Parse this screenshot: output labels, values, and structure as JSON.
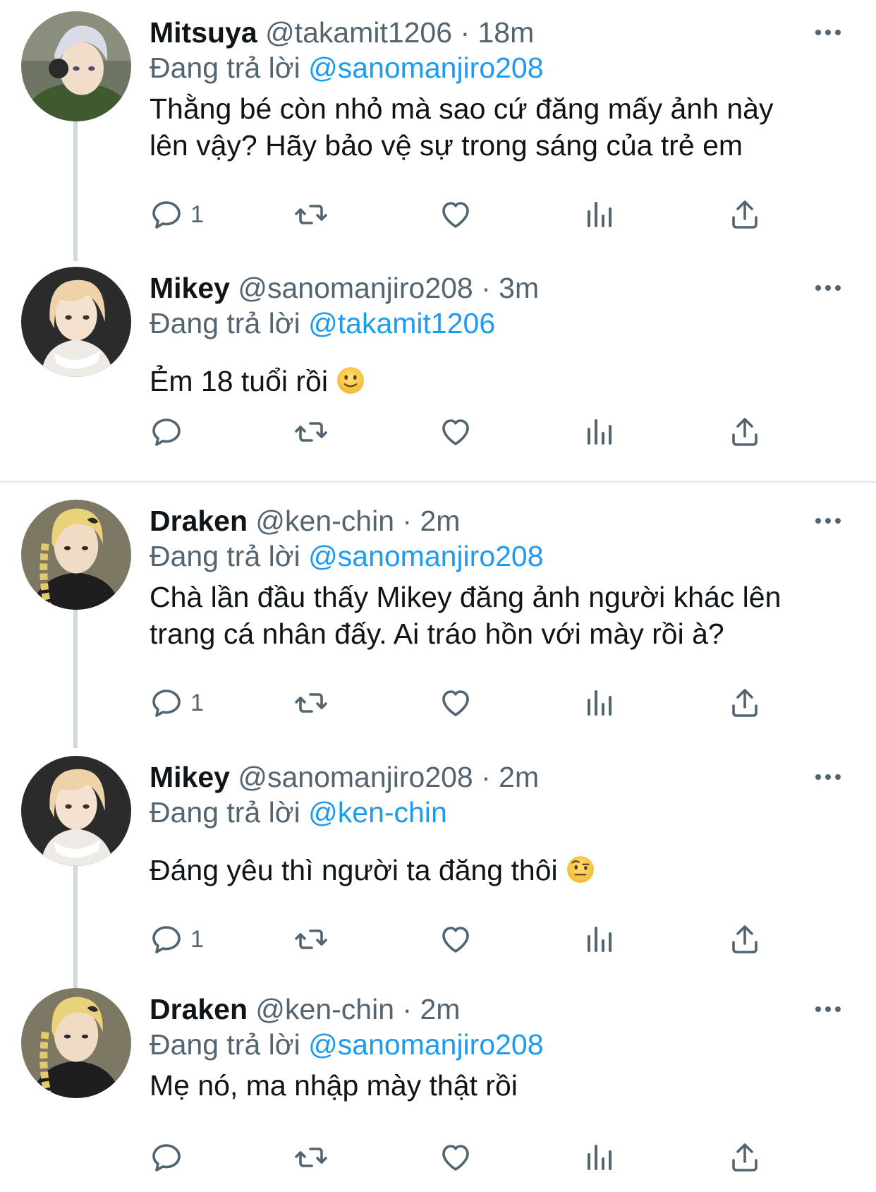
{
  "colors": {
    "text_primary": "#0f1419",
    "text_secondary": "#536471",
    "accent": "#1d9bf0",
    "thread_line": "#cfd9de",
    "divider": "#e6ecf0"
  },
  "reply_prefix": "Đang trả lời",
  "tweets": [
    {
      "name": "Mitsuya",
      "handle": "@takamit1206",
      "time": "· 18m",
      "reply_to": "@sanomanjiro208",
      "text_lines": [
        "Thằng bé còn nhỏ mà sao cứ đăng mấy ảnh này",
        "lên vậy? Hãy bảo vệ sự trong sáng của trẻ em"
      ],
      "reply_count": "1",
      "avatar_icon": "mitsuya-avatar"
    },
    {
      "name": "Mikey",
      "handle": "@sanomanjiro208",
      "time": "· 3m",
      "reply_to": "@takamit1206",
      "text_lines": [
        "Ẻm 18 tuổi rồi"
      ],
      "emoji": "slightly-smiling-face",
      "reply_count": "",
      "avatar_icon": "mikey-avatar"
    },
    {
      "name": "Draken",
      "handle": "@ken-chin",
      "time": "· 2m",
      "reply_to": "@sanomanjiro208",
      "text_lines": [
        "Chà lần đầu thấy Mikey đăng ảnh người khác lên",
        "trang cá nhân đấy. Ai tráo hồn với mày rồi à?"
      ],
      "reply_count": "1",
      "avatar_icon": "draken-avatar"
    },
    {
      "name": "Mikey",
      "handle": "@sanomanjiro208",
      "time": "· 2m",
      "reply_to": "@ken-chin",
      "text_lines": [
        "Đáng yêu thì người ta đăng thôi"
      ],
      "emoji": "face-with-raised-eyebrow",
      "reply_count": "1",
      "avatar_icon": "mikey-avatar"
    },
    {
      "name": "Draken",
      "handle": "@ken-chin",
      "time": "· 2m",
      "reply_to": "@sanomanjiro208",
      "text_lines": [
        "Mẹ nó, ma nhập mày thật rồi"
      ],
      "reply_count": "",
      "avatar_icon": "draken-avatar"
    }
  ]
}
